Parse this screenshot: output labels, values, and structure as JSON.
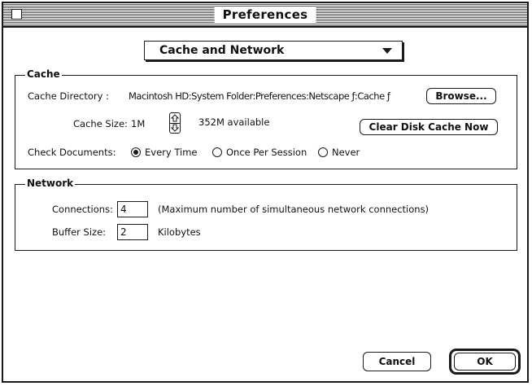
{
  "window": {
    "title": "Preferences"
  },
  "panel_popup": {
    "selected": "Cache and Network"
  },
  "cache": {
    "group_label": "Cache",
    "directory_label": "Cache Directory :",
    "directory_path": "Macintosh HD:System Folder:Preferences:Netscape ƒ:Cache ƒ",
    "browse_button": "Browse...",
    "size_label": "Cache Size:",
    "size_value": "1M",
    "available_text": "352M available",
    "clear_button": "Clear Disk Cache Now",
    "check_docs_label": "Check Documents:",
    "check_options": [
      {
        "label": "Every Time",
        "selected": true
      },
      {
        "label": "Once Per Session",
        "selected": false
      },
      {
        "label": "Never",
        "selected": false
      }
    ]
  },
  "network": {
    "group_label": "Network",
    "connections_label": "Connections:",
    "connections_value": "4",
    "connections_hint": "(Maximum number of simultaneous network connections)",
    "buffer_label": "Buffer Size:",
    "buffer_value": "2",
    "buffer_unit": "Kilobytes"
  },
  "footer": {
    "cancel_button": "Cancel",
    "ok_button": "OK"
  },
  "colors": {
    "ink": "#1a1a1a",
    "background": "#ffffff",
    "stripe": "#5a5a5a"
  }
}
